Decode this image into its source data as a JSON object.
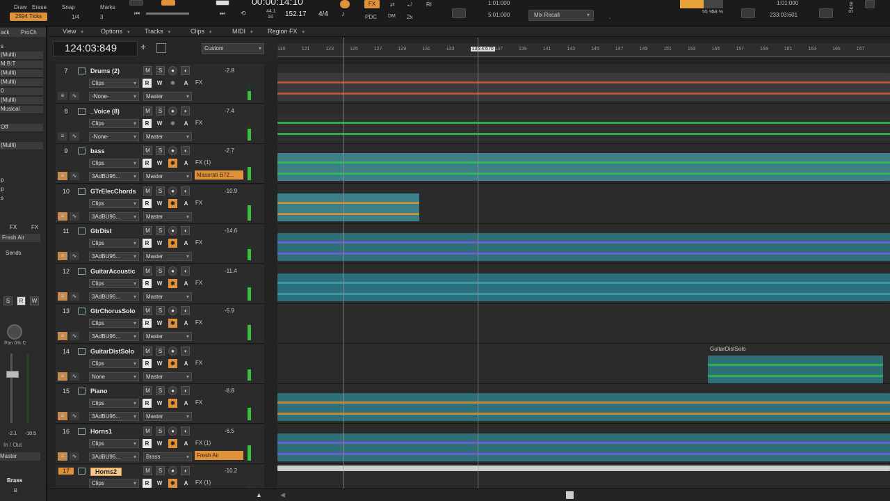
{
  "transport": {
    "snap_label": "Snap",
    "marks_label": "Marks",
    "draw_label": "Draw",
    "erase_label": "Erase",
    "ticks_value": "2594 Ticks",
    "snap_division": "1/4",
    "snap_count": "3",
    "time_display": "00:00:14:10",
    "bpm": "152.17",
    "sample_rate": "44.1",
    "bit_depth": "16",
    "meter": "4/4",
    "fx_label": "FX",
    "pdc_label": "PDC",
    "dim_label": "DM",
    "x2_label": "2x",
    "ri_label": "RI",
    "loop_start": "1:01:000",
    "loop_end": "5:01:000",
    "mix_recall": "Mix Recall",
    "cpu1": "55 %",
    "cpu2": "58 %",
    "pos1": "1:01:000",
    "pos2": "233:03:601",
    "screen_label": "Scre"
  },
  "inspector": {
    "tabs": [
      "ack",
      "ProCh"
    ],
    "rows": [
      "s",
      "(Multi)",
      "M:B:T",
      "(Multi)",
      "(Multi)",
      "0",
      "(Multi)",
      "Musical",
      "",
      "Off",
      "(Multi)",
      "",
      "",
      "p",
      "p",
      "s"
    ],
    "fx_label": "FX",
    "fresh_air": "Fresh Air",
    "sends_label": "Sends",
    "s_label": "S",
    "r_label": "R",
    "w_label": "W",
    "pan_label": "Pan 0% C",
    "level_left": "-2.1",
    "level_right": "-10.5",
    "in_out_label": "In / Out",
    "output": "Master",
    "bus_name": "Brass",
    "bus_letter": "B"
  },
  "menu": {
    "items": [
      "View",
      "Options",
      "Tracks",
      "Clips",
      "MIDI",
      "Region FX"
    ]
  },
  "toolbar": {
    "time": "124:03:849",
    "add_label": "+",
    "preset": "Custom"
  },
  "ruler": {
    "ticks": [
      "119",
      "121",
      "123",
      "125",
      "127",
      "129",
      "131",
      "133",
      "135:4:670",
      "137",
      "139",
      "141",
      "143",
      "145",
      "147",
      "149",
      "151",
      "153",
      "155",
      "157",
      "159",
      "161",
      "163",
      "165",
      "167"
    ]
  },
  "tracks": [
    {
      "num": "7",
      "name": "Drums (2)",
      "vol": "-2.8",
      "clips": "Clips",
      "input": "-None-",
      "output": "Master",
      "fx": "FX",
      "patch": ""
    },
    {
      "num": "8",
      "name": "_Voice (8)",
      "vol": "-7.4",
      "clips": "Clips",
      "input": "-None-",
      "output": "Master",
      "fx": "FX",
      "patch": ""
    },
    {
      "num": "9",
      "name": "bass",
      "vol": "-2.7",
      "clips": "Clips",
      "input": "3AdBU96...",
      "output": "Master",
      "fx": "FX (1)",
      "patch": "Maserati B72..."
    },
    {
      "num": "10",
      "name": "GTrElecChords",
      "vol": "-10.9",
      "clips": "Clips",
      "input": "3AdBU96...",
      "output": "Master",
      "fx": "FX",
      "patch": ""
    },
    {
      "num": "11",
      "name": "GtrDist",
      "vol": "-14.6",
      "clips": "Clips",
      "input": "3AdBU96...",
      "output": "Master",
      "fx": "FX",
      "patch": ""
    },
    {
      "num": "12",
      "name": "GuitarAcoustic",
      "vol": "-11.4",
      "clips": "Clips",
      "input": "3AdBU96...",
      "output": "Master",
      "fx": "FX",
      "patch": ""
    },
    {
      "num": "13",
      "name": "GtrChorusSolo",
      "vol": "-5.9",
      "clips": "Clips",
      "input": "3AdBU96...",
      "output": "Master",
      "fx": "FX",
      "patch": ""
    },
    {
      "num": "14",
      "name": "GuitarDistSolo",
      "vol": "",
      "clips": "Clips",
      "input": "None",
      "output": "Master",
      "fx": "FX",
      "patch": ""
    },
    {
      "num": "15",
      "name": "Piano",
      "vol": "-8.8",
      "clips": "Clips",
      "input": "3AdBU96...",
      "output": "Master",
      "fx": "FX",
      "patch": ""
    },
    {
      "num": "16",
      "name": "Horns1",
      "vol": "-6.5",
      "clips": "Clips",
      "input": "3AdBU96...",
      "output": "Brass",
      "fx": "FX (1)",
      "patch": "Fresh Air"
    },
    {
      "num": "17",
      "name": "Horns2",
      "vol": "-10.2",
      "clips": "Clips",
      "input": "",
      "output": "",
      "fx": "FX (1)",
      "patch": ""
    }
  ],
  "clip_names": {
    "guitar_dist_solo": "GuitarDistSolo"
  },
  "colors": {
    "accent": "#e0923b",
    "drums_wave": "#d2533a",
    "voice_wave": "#2fbf4a",
    "bass_clip": "#3d7f88",
    "purple_wave": "#7a5ae0",
    "teal_clip": "#2f6f7a"
  }
}
